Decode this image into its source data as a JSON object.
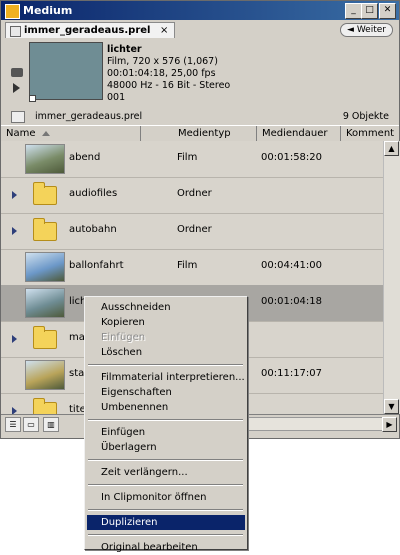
{
  "window": {
    "title": "Medium",
    "controls": [
      "_",
      "□",
      "✕"
    ]
  },
  "tab": {
    "label": "immer_geradeaus.prel",
    "close": "×",
    "weiter": "Weiter"
  },
  "clip": {
    "name": "lichter",
    "line1": "Film, 720 x 576 (1,067)",
    "line2": "00:01:04:18, 25,00 fps",
    "line3": "48000 Hz - 16 Bit - Stereo",
    "line4": "001"
  },
  "path": {
    "project": "immer_geradeaus.prel",
    "count": "9 Objekte"
  },
  "columns": [
    "Name",
    "Medientyp",
    "Mediendauer",
    "Komment"
  ],
  "rows": [
    {
      "name": "abend",
      "type": "Film",
      "duration": "00:01:58:20",
      "kind": "film",
      "thumb": "#7a8c68"
    },
    {
      "name": "audiofiles",
      "type": "Ordner",
      "duration": "",
      "kind": "folder"
    },
    {
      "name": "autobahn",
      "type": "Ordner",
      "duration": "",
      "kind": "folder"
    },
    {
      "name": "ballonfahrt",
      "type": "Film",
      "duration": "00:04:41:00",
      "kind": "film",
      "thumb": "#6c98c8"
    },
    {
      "name": "lichter",
      "type": "Film",
      "duration": "00:01:04:18",
      "kind": "film",
      "thumb": "#6f8d94",
      "selected": true
    },
    {
      "name": "mat",
      "type": "",
      "duration": "",
      "kind": "folder"
    },
    {
      "name": "stad",
      "type": "",
      "duration": "00:11:17:07",
      "kind": "film",
      "thumb": "#b9a45a"
    },
    {
      "name": "titel",
      "type": "",
      "duration": "",
      "kind": "folder"
    }
  ],
  "menu": {
    "items": [
      {
        "label": "Ausschneiden",
        "name": "menu-item-ausschneiden"
      },
      {
        "label": "Kopieren",
        "name": "menu-item-kopieren"
      },
      {
        "label": "Einfügen",
        "name": "menu-item-einfuegen-disabled",
        "disabled": true
      },
      {
        "label": "Löschen",
        "name": "menu-item-loeschen"
      },
      {
        "sep": true
      },
      {
        "label": "Filmmaterial interpretieren...",
        "name": "menu-item-filmmaterial-interpretieren"
      },
      {
        "label": "Eigenschaften",
        "name": "menu-item-eigenschaften"
      },
      {
        "label": "Umbenennen",
        "name": "menu-item-umbenennen"
      },
      {
        "sep": true
      },
      {
        "label": "Einfügen",
        "name": "menu-item-einfuegen"
      },
      {
        "label": "Überlagern",
        "name": "menu-item-ueberlagern"
      },
      {
        "sep": true
      },
      {
        "label": "Zeit verlängern...",
        "name": "menu-item-zeit-verlaengern"
      },
      {
        "sep": true
      },
      {
        "label": "In Clipmonitor öffnen",
        "name": "menu-item-in-clipmonitor-oeffnen"
      },
      {
        "sep": true
      },
      {
        "label": "Duplizieren",
        "name": "menu-item-duplizieren",
        "highlighted": true
      },
      {
        "sep": true
      },
      {
        "label": "Original bearbeiten",
        "name": "menu-item-original-bearbeiten"
      }
    ]
  },
  "colors": {
    "titlebar": "#0a246a",
    "menu_highlight": "#0a246a",
    "folder": "#f4d35a",
    "selected_row": "#a8a6a2"
  }
}
